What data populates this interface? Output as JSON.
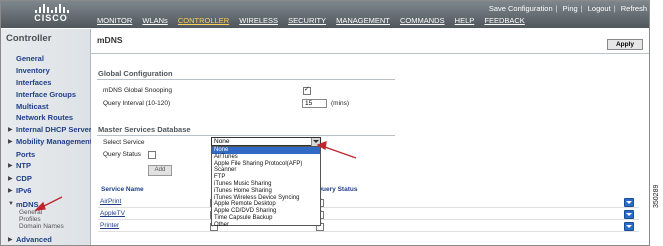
{
  "topbar": {
    "logo_text": "CISCO",
    "links": [
      "Save Configuration",
      "Ping",
      "Logout",
      "Refresh"
    ],
    "nav": [
      "MONITOR",
      "WLANs",
      "CONTROLLER",
      "WIRELESS",
      "SECURITY",
      "MANAGEMENT",
      "COMMANDS",
      "HELP",
      "FEEDBACK"
    ],
    "active_nav": "CONTROLLER"
  },
  "sidebar": {
    "title": "Controller",
    "items": [
      "General",
      "Inventory",
      "Interfaces",
      "Interface Groups",
      "Multicast",
      "Network Routes",
      "Internal DHCP Server",
      "Mobility Management",
      "Ports",
      "NTP",
      "CDP",
      "IPv6",
      "mDNS",
      "Advanced"
    ],
    "mdns_sub": [
      "General",
      "Profiles",
      "Domain Names"
    ]
  },
  "main": {
    "title": "mDNS",
    "apply_label": "Apply",
    "global_section": "Global Configuration",
    "snooping_label": "mDNS Global Snooping",
    "query_interval_label": "Query Interval (10-120)",
    "query_interval_value": "15",
    "query_interval_unit": "(mins)",
    "master_section": "Master Services Database",
    "select_service_label": "Select Service",
    "select_service_value": "None",
    "query_status_label": "Query Status",
    "add_label": "Add",
    "dropdown_options": [
      "None",
      "AirTunes",
      "Apple File Sharing Protocol(AFP)",
      "Scanner",
      "FTP",
      "iTunes Music Sharing",
      "iTunes Home Sharing",
      "iTunes Wireless Device Syncing",
      "Apple Remote Desktop",
      "Apple CD/DVD Sharing",
      "Time Capsule Backup",
      "Other"
    ],
    "table_headers": [
      "Service Name",
      "S",
      "Query Status"
    ],
    "rows": [
      "AirPrint",
      "AppleTV",
      "Printer"
    ]
  },
  "figure_id": "350289",
  "colors": {
    "accent": "#1f3f88",
    "annotation": "#c0262c",
    "selection": "#316ac5"
  }
}
